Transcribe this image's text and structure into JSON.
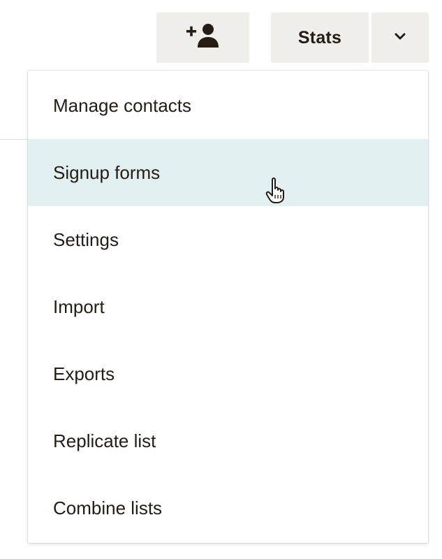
{
  "toolbar": {
    "add_contact_icon": "add-person-icon",
    "stats_label": "Stats",
    "caret_icon": "chevron-down-icon"
  },
  "menu": {
    "items": [
      {
        "label": "Manage contacts"
      },
      {
        "label": "Signup forms",
        "highlighted": true
      },
      {
        "label": "Settings"
      },
      {
        "label": "Import"
      },
      {
        "label": "Exports"
      },
      {
        "label": "Replicate list"
      },
      {
        "label": "Combine lists"
      }
    ],
    "highlight_color": "#e2eff0"
  },
  "cursor_icon": "hand-pointer-icon"
}
